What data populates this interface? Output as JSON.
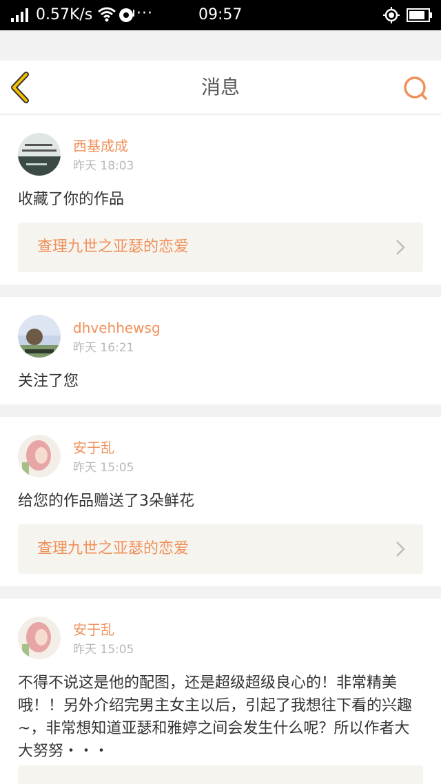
{
  "status_bar": {
    "speed": "0.57K/s",
    "dots": "···",
    "time": "09:57",
    "icons": [
      "signal-icon",
      "wifi-icon",
      "notification-icon",
      "gps-icon",
      "battery-icon"
    ]
  },
  "header": {
    "title": "消息",
    "back_icon": "chevron-left-icon",
    "search_icon": "search-icon",
    "accent_color": "#f0905a",
    "back_color": "#f5c000"
  },
  "messages": [
    {
      "username": "西基成成",
      "time": "昨天 18:03",
      "text": "收藏了你的作品",
      "work_title": "查理九世之亚瑟的恋爱"
    },
    {
      "username": "dhvehhewsg",
      "time": "昨天 16:21",
      "text": "关注了您"
    },
    {
      "username": "安于乱",
      "time": "昨天 15:05",
      "text": "给您的作品赠送了3朵鲜花",
      "work_title": "查理九世之亚瑟的恋爱"
    },
    {
      "username": "安于乱",
      "time": "昨天 15:05",
      "text": "不得不说这是他的配图，还是超级超级良心的！非常精美哦！！另外介绍完男主女主以后，引起了我想往下看的兴趣~，非常想知道亚瑟和雅婷之间会发生什么呢？所以作者大大努努・・・"
    }
  ],
  "colors": {
    "name": "#f0905a",
    "link_bg": "#f5f4ef",
    "page_bg": "#f2f2f2"
  }
}
